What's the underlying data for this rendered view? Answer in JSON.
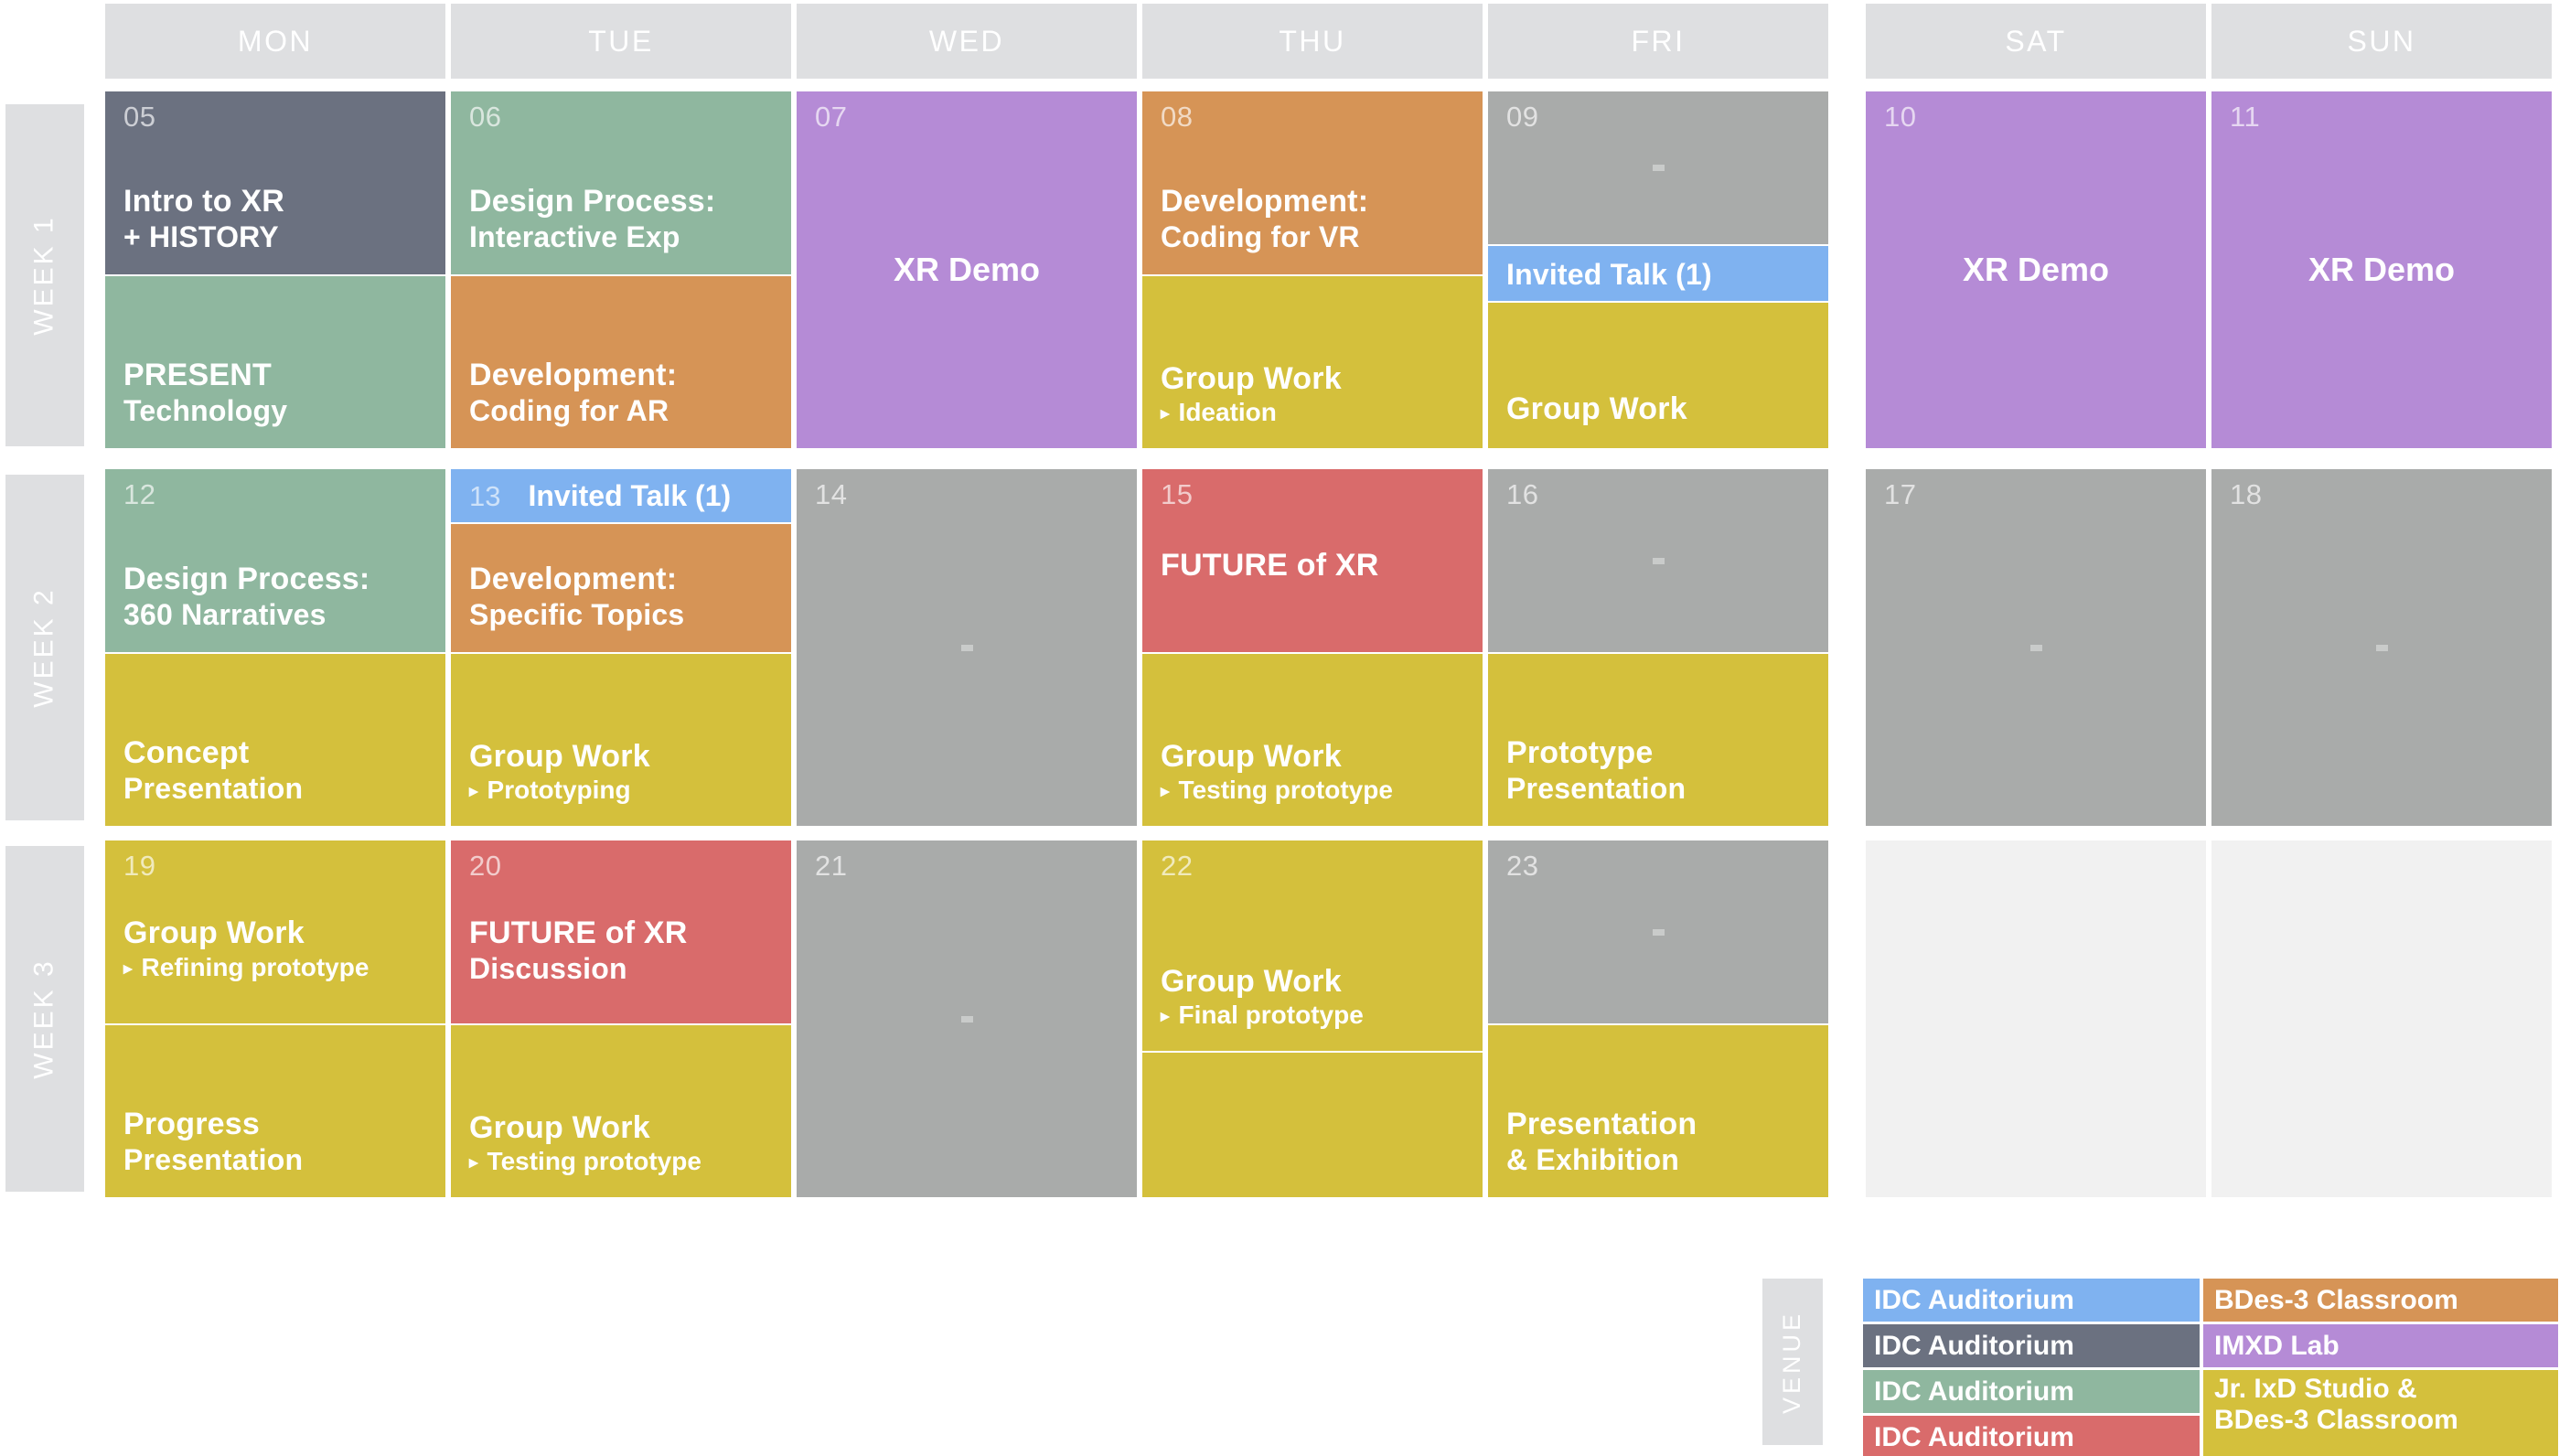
{
  "palette": {
    "slate": "#6B7180",
    "sage": "#8FB79F",
    "purple": "#B58BD6",
    "orange": "#D69456",
    "gray": "#A9ABAA",
    "blue": "#7FB2F0",
    "yellow": "#D4C03C",
    "red": "#D96B6B",
    "header_gray": "#DEDFE1",
    "empty_light": "#F1F1F1"
  },
  "header": {
    "days": [
      "MON",
      "TUE",
      "WED",
      "THU",
      "FRI",
      "SAT",
      "SUN"
    ]
  },
  "weeks": [
    {
      "label": "WEEK 1"
    },
    {
      "label": "WEEK 2"
    },
    {
      "label": "WEEK 3"
    }
  ],
  "cells": {
    "d05": {
      "date": "05",
      "title": "Intro to XR",
      "sub": "+ HISTORY"
    },
    "d05b": {
      "title": "PRESENT",
      "sub": "Technology"
    },
    "d06": {
      "date": "06",
      "title": "Design Process:",
      "sub": "Interactive Exp"
    },
    "d06b": {
      "title": "Development:",
      "sub": "Coding for AR"
    },
    "d07": {
      "date": "07",
      "title": "XR Demo"
    },
    "d08": {
      "date": "08",
      "title": "Development:",
      "sub": "Coding for VR"
    },
    "d08b": {
      "title": "Group Work",
      "sub": "Ideation"
    },
    "d09": {
      "date": "09"
    },
    "d09b": {
      "title": "Invited Talk (1)"
    },
    "d09c": {
      "title": "Group Work"
    },
    "d10": {
      "date": "10",
      "title": "XR Demo"
    },
    "d11": {
      "date": "11",
      "title": "XR Demo"
    },
    "d12": {
      "date": "12",
      "title": "Design Process:",
      "sub": "360 Narratives"
    },
    "d12b": {
      "title": "Concept",
      "sub": "Presentation"
    },
    "d13": {
      "date": "13",
      "title": "Invited Talk (1)"
    },
    "d13b": {
      "title": "Development:",
      "sub": "Specific Topics"
    },
    "d13c": {
      "title": "Group Work",
      "sub": "Prototyping"
    },
    "d14": {
      "date": "14"
    },
    "d15": {
      "date": "15",
      "title": "FUTURE of XR"
    },
    "d15b": {
      "title": "Group Work",
      "sub": "Testing prototype"
    },
    "d16": {
      "date": "16"
    },
    "d16b": {
      "title": "Prototype",
      "sub": "Presentation"
    },
    "d17": {
      "date": "17"
    },
    "d18": {
      "date": "18"
    },
    "d19": {
      "date": "19",
      "title": "Group Work",
      "sub": "Refining prototype"
    },
    "d19b": {
      "title": "Progress",
      "sub": "Presentation"
    },
    "d20": {
      "date": "20",
      "title": "FUTURE of XR",
      "sub": "Discussion"
    },
    "d20b": {
      "title": "Group Work",
      "sub": "Testing prototype"
    },
    "d21": {
      "date": "21"
    },
    "d22": {
      "date": "22",
      "title": "Group Work",
      "sub": "Final prototype"
    },
    "d23": {
      "date": "23"
    },
    "d23b": {
      "title": "Presentation",
      "sub": "& Exhibition"
    }
  },
  "legend": {
    "venue_label": "VENUE",
    "left": [
      {
        "text": "IDC Auditorium",
        "color": "#7FB2F0"
      },
      {
        "text": "IDC Auditorium",
        "color": "#6B7180"
      },
      {
        "text": "IDC Auditorium",
        "color": "#8FB79F"
      },
      {
        "text": "IDC Auditorium",
        "color": "#D96B6B"
      }
    ],
    "right": [
      {
        "text": "BDes-3 Classroom",
        "color": "#D69456"
      },
      {
        "text": "IMXD Lab",
        "color": "#B58BD6"
      },
      {
        "text": "Jr. IxD Studio &\nBDes-3 Classroom",
        "color": "#D4C03C"
      }
    ]
  },
  "arrow_glyph": "▸"
}
